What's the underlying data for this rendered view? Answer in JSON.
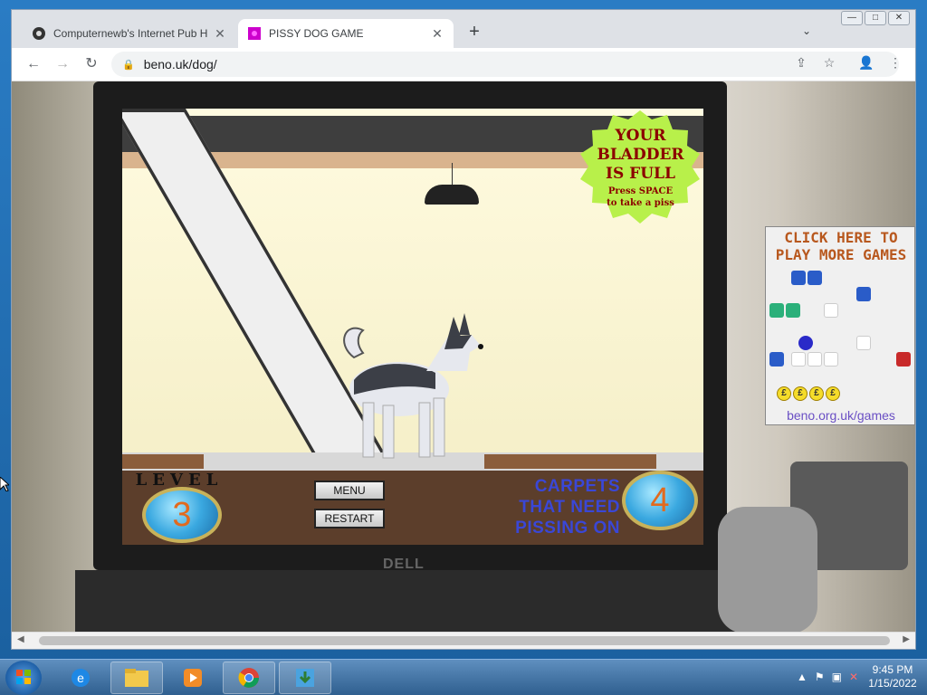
{
  "browser": {
    "tabs": [
      {
        "title": "Computernewb's Internet Pub H",
        "active": false,
        "favicon": "pub-favicon-icon"
      },
      {
        "title": "PISSY DOG GAME",
        "active": true,
        "favicon": "dog-favicon-icon",
        "favicon_color": "#cc00cc"
      }
    ],
    "new_tab": "+",
    "tab_search": "⌄",
    "window_controls": {
      "minimize": "—",
      "maximize": "□",
      "close": "✕"
    },
    "nav": {
      "back": "←",
      "forward": "→",
      "reload": "↻"
    },
    "url": "beno.uk/dog/",
    "lock": "🔒",
    "share": "⇪",
    "bookmark": "☆",
    "profile": "👤",
    "menu": "⋮"
  },
  "game": {
    "bladder_badge": {
      "line1": "YOUR",
      "line2": "BLADDER",
      "line3": "IS FULL",
      "hint1": "Press SPACE",
      "hint2": "to take a piss",
      "color": "#b8f04a"
    },
    "level_label": "LEVEL",
    "level_value": "3",
    "menu_button": "MENU",
    "restart_button": "RESTART",
    "carpets_line1": "CARPETS",
    "carpets_line2": "THAT NEED",
    "carpets_line3": "PISSING ON",
    "carpets_value": "4"
  },
  "ad": {
    "title_line1": "CLICK HERE TO",
    "title_line2": "PLAY MORE GAMES",
    "coins": [
      "£",
      "£",
      "£",
      "£"
    ],
    "url": "beno.org.uk/games"
  },
  "taskbar": {
    "items": [
      "ie-icon",
      "explorer-icon",
      "media-player-icon",
      "chrome-icon",
      "download-app-icon"
    ],
    "time": "9:45 PM",
    "date": "1/15/2022"
  }
}
